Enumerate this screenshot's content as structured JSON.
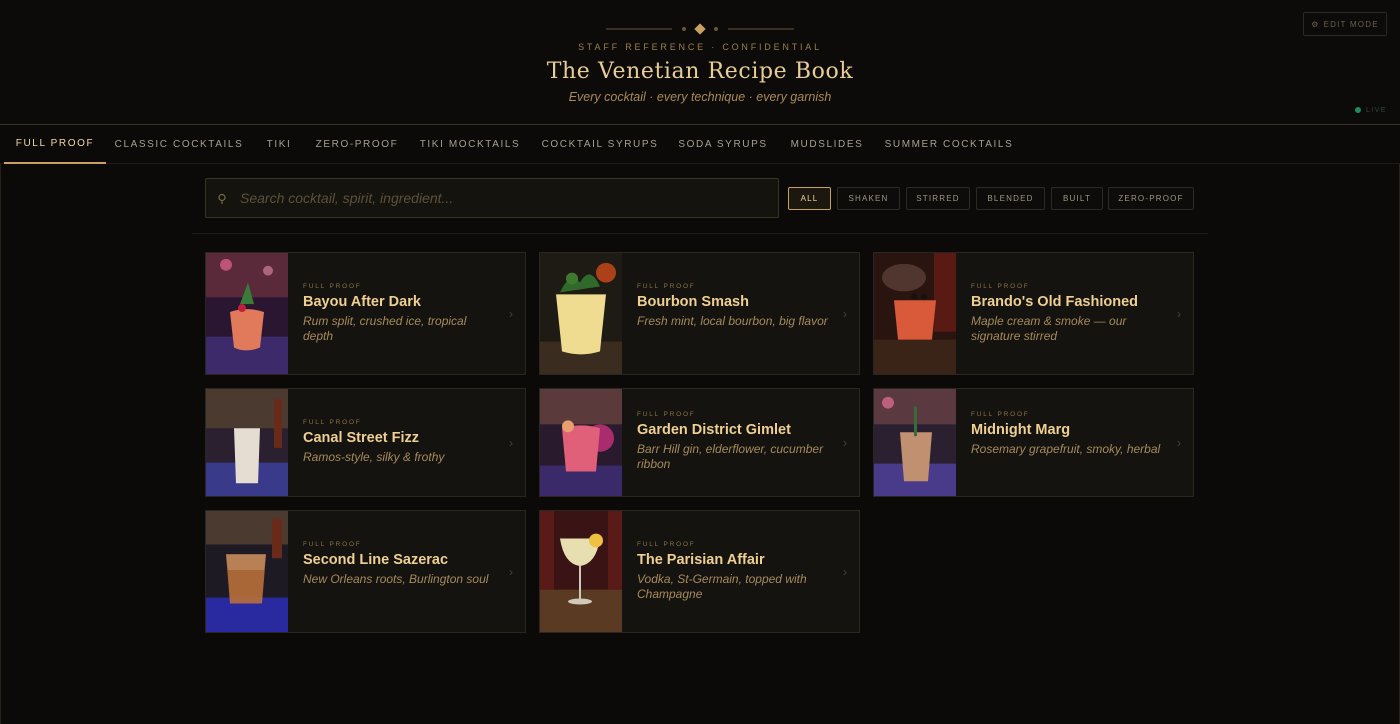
{
  "header": {
    "eyebrow": "STAFF REFERENCE · CONFIDENTIAL",
    "title": "The Venetian Recipe Book",
    "subtitle": "Every cocktail · every technique · every garnish",
    "edit_mode_label": "EDIT MODE",
    "edit_icon": "gear-icon",
    "live_label": "LIVE"
  },
  "colors": {
    "accent": "#c9a063",
    "title": "#e9cd96",
    "background": "#0b0a08",
    "card": "#14130f",
    "live": "#1f8a5a"
  },
  "tabs": [
    {
      "label": "FULL PROOF",
      "active": true
    },
    {
      "label": "CLASSIC COCKTAILS",
      "active": false
    },
    {
      "label": "TIKI",
      "active": false
    },
    {
      "label": "ZERO-PROOF",
      "active": false
    },
    {
      "label": "TIKI MOCKTAILS",
      "active": false
    },
    {
      "label": "COCKTAIL SYRUPS",
      "active": false
    },
    {
      "label": "SODA SYRUPS",
      "active": false
    },
    {
      "label": "MUDSLIDES",
      "active": false
    },
    {
      "label": "SUMMER COCKTAILS",
      "active": false
    }
  ],
  "search": {
    "placeholder": "Search cocktail, spirit, ingredient...",
    "value": "",
    "icon": "search-icon"
  },
  "filters": [
    {
      "label": "ALL",
      "active": true
    },
    {
      "label": "SHAKEN",
      "active": false
    },
    {
      "label": "STIRRED",
      "active": false
    },
    {
      "label": "BLENDED",
      "active": false
    },
    {
      "label": "BUILT",
      "active": false
    },
    {
      "label": "ZERO-PROOF",
      "active": false
    }
  ],
  "cards": [
    {
      "category": "FULL PROOF",
      "name": "Bayou After Dark",
      "description": "Rum split, crushed ice, tropical depth"
    },
    {
      "category": "FULL PROOF",
      "name": "Bourbon Smash",
      "description": "Fresh mint, local bourbon, big flavor"
    },
    {
      "category": "FULL PROOF",
      "name": "Brando's Old Fashioned",
      "description": "Maple cream & smoke — our signature stirred"
    },
    {
      "category": "FULL PROOF",
      "name": "Canal Street Fizz",
      "description": "Ramos-style, silky & frothy"
    },
    {
      "category": "FULL PROOF",
      "name": "Garden District Gimlet",
      "description": "Barr Hill gin, elderflower, cucumber ribbon"
    },
    {
      "category": "FULL PROOF",
      "name": "Midnight Marg",
      "description": "Rosemary grapefruit, smoky, herbal"
    },
    {
      "category": "FULL PROOF",
      "name": "Second Line Sazerac",
      "description": "New Orleans roots, Burlington soul"
    },
    {
      "category": "FULL PROOF",
      "name": "The Parisian Affair",
      "description": "Vodka, St-Germain, topped with Champagne"
    }
  ],
  "chevron_glyph": "›"
}
